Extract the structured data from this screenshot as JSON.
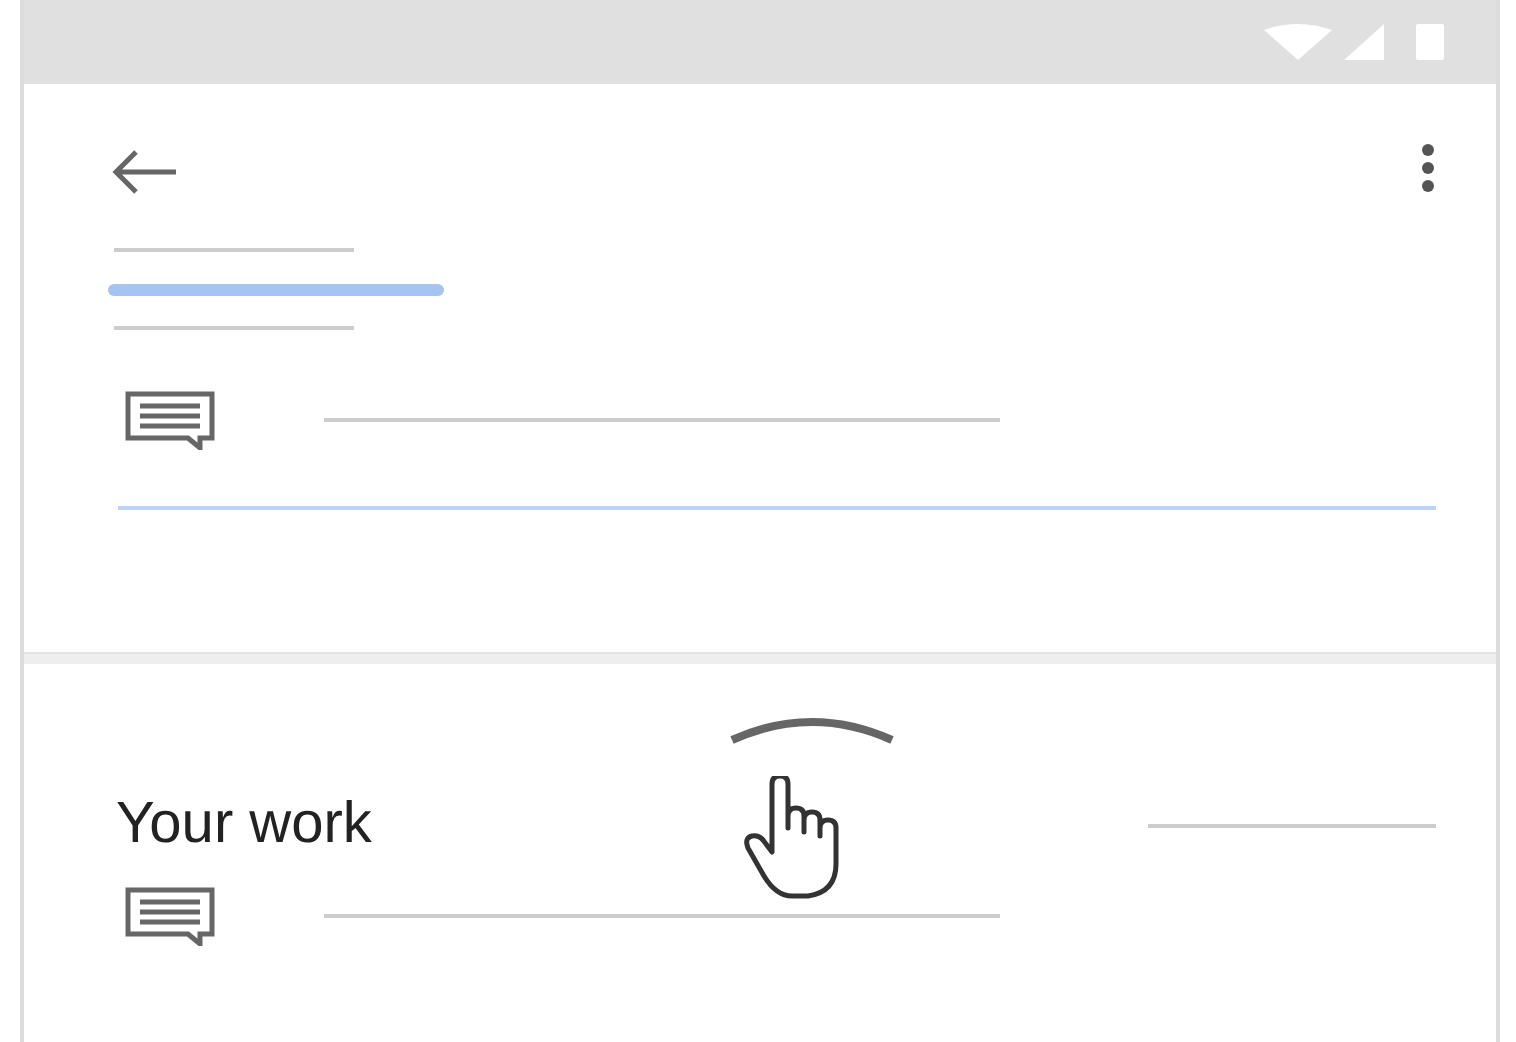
{
  "work_section": {
    "title": "Your work"
  }
}
